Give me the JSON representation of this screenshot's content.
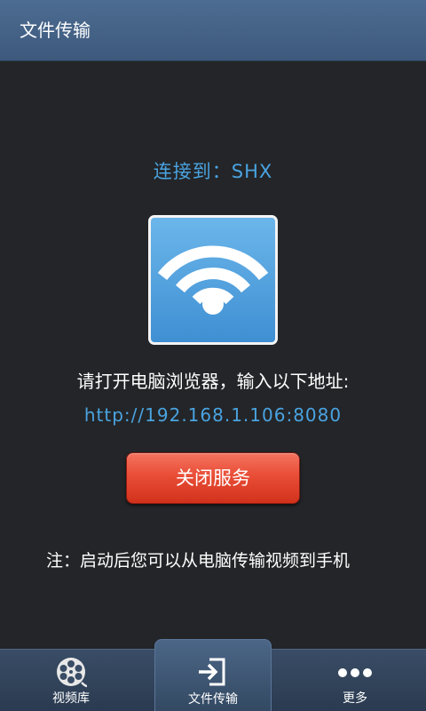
{
  "header": {
    "title": "文件传输"
  },
  "main": {
    "connected_label": "连接到：SHX",
    "instruction": "请打开电脑浏览器，输入以下地址:",
    "address": "http://192.168.1.106:8080",
    "close_button_label": "关闭服务",
    "note": "注：启动后您可以从电脑传输视频到手机"
  },
  "bottom_nav": {
    "items": [
      {
        "label": "视频库",
        "icon": "film-reel-icon",
        "active": false
      },
      {
        "label": "文件传输",
        "icon": "file-transfer-icon",
        "active": true
      },
      {
        "label": "更多",
        "icon": "more-dots-icon",
        "active": false
      }
    ]
  },
  "colors": {
    "header": "#4d6c91",
    "background": "#232528",
    "accent_blue": "#4aa3e0",
    "button_red": "#e94d36",
    "nav_bar": "#2f4158"
  }
}
